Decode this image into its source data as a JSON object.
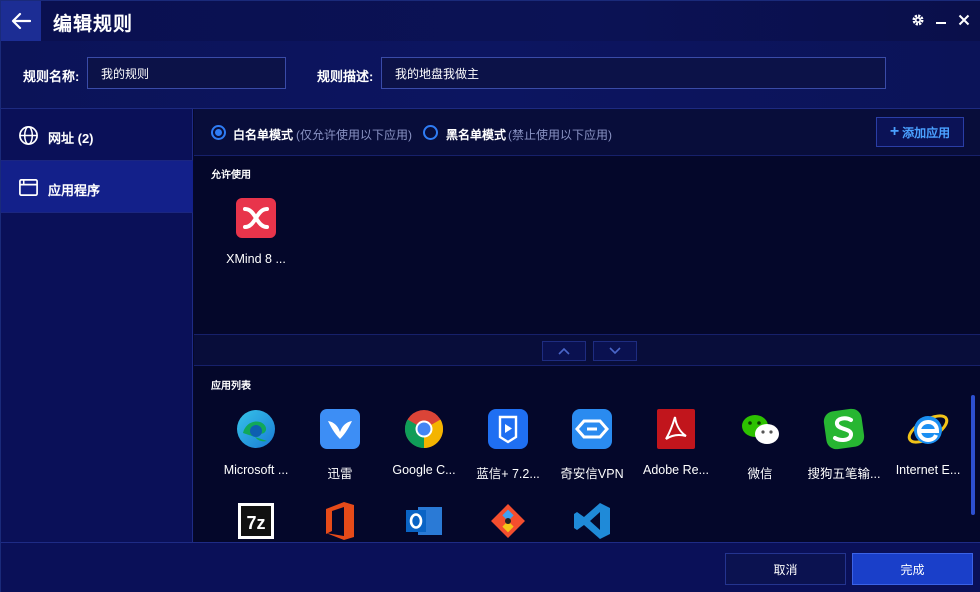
{
  "window": {
    "title": "编辑规则",
    "back_icon": "arrow-left-icon",
    "controls": [
      "gear-icon",
      "minimize-icon",
      "close-icon"
    ]
  },
  "header": {
    "name_label": "规则名称:",
    "name_value": "我的规则",
    "desc_label": "规则描述:",
    "desc_value": "我的地盘我做主"
  },
  "sidebar": {
    "items": [
      {
        "label": "网址 (2)",
        "icon": "globe-icon",
        "active": false
      },
      {
        "label": "应用程序",
        "icon": "window-icon",
        "active": true
      }
    ]
  },
  "mode": {
    "whitelist_label": "白名单模式",
    "whitelist_sub": "(仅允许使用以下应用)",
    "blacklist_label": "黑名单模式",
    "blacklist_sub": "(禁止使用以下应用)",
    "selected": "whitelist",
    "add_button": "添加应用"
  },
  "allowed": {
    "title": "允许使用",
    "apps": [
      {
        "name": "XMind 8 ...",
        "icon": "xmind-icon"
      }
    ]
  },
  "app_list": {
    "title": "应用列表",
    "apps": [
      {
        "name": "Microsoft ...",
        "icon": "edge-icon"
      },
      {
        "name": "迅雷",
        "icon": "xunlei-icon"
      },
      {
        "name": "Google C...",
        "icon": "chrome-icon"
      },
      {
        "name": "蓝信+ 7.2...",
        "icon": "lanxin-icon"
      },
      {
        "name": "奇安信VPN",
        "icon": "qianxin-vpn-icon"
      },
      {
        "name": "Adobe Re...",
        "icon": "adobe-reader-icon"
      },
      {
        "name": "微信",
        "icon": "wechat-icon"
      },
      {
        "name": "搜狗五笔输...",
        "icon": "sogou-icon"
      },
      {
        "name": "Internet E...",
        "icon": "ie-icon"
      },
      {
        "name": "",
        "icon": "7zip-icon"
      },
      {
        "name": "",
        "icon": "office-icon"
      },
      {
        "name": "",
        "icon": "outlook-icon"
      },
      {
        "name": "",
        "icon": "git-icon"
      },
      {
        "name": "",
        "icon": "vscode-icon"
      }
    ]
  },
  "footer": {
    "cancel": "取消",
    "confirm": "完成"
  },
  "colors": {
    "accent": "#2f7cf5",
    "background": "#05082a",
    "sidebar": "#0a1058",
    "primary_button": "#1a3fc9"
  }
}
